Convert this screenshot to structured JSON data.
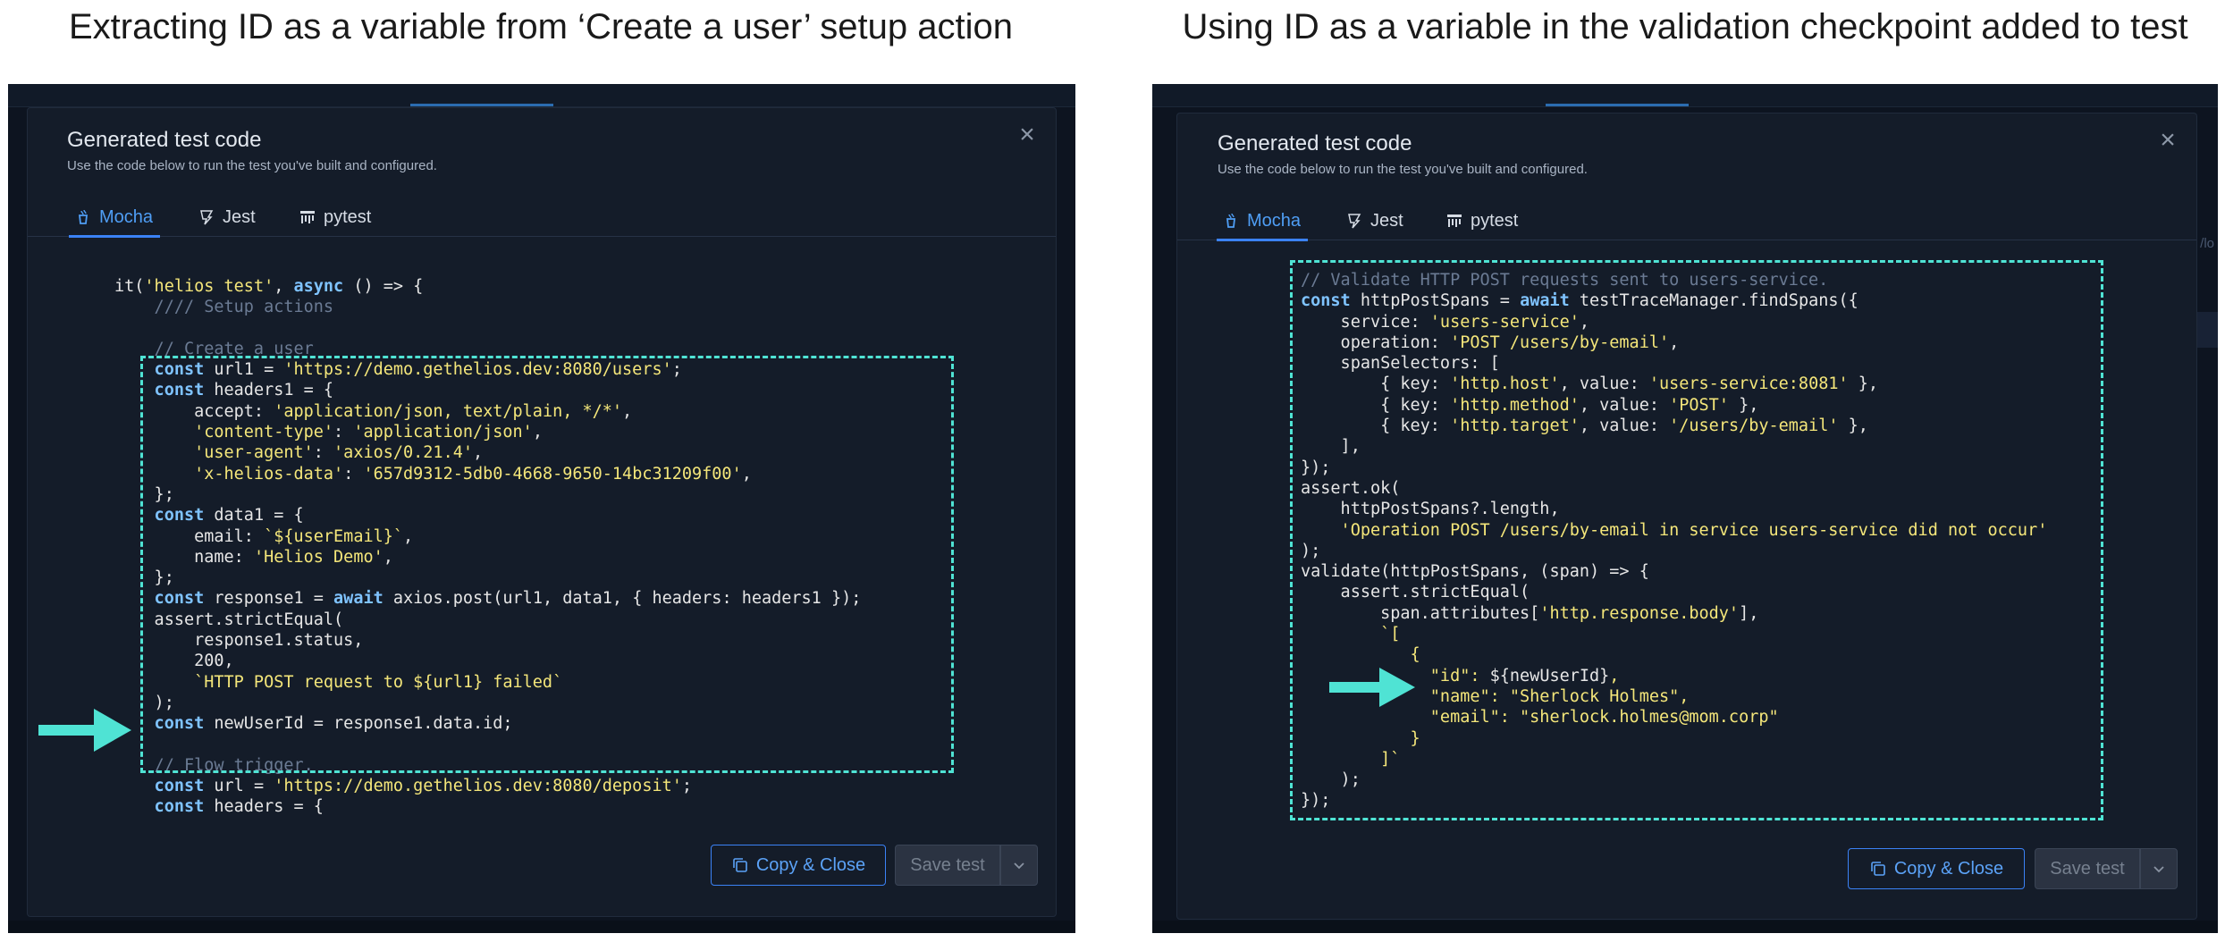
{
  "captions": {
    "left": "Extracting ID as a variable from ‘Create a user’ setup action",
    "right": "Using ID as a variable in the validation checkpoint added to test"
  },
  "modal": {
    "title": "Generated test code",
    "subtitle": "Use the code below to run the test you've built and configured.",
    "close_icon": "close-icon",
    "tabs": [
      {
        "label": "Mocha",
        "icon": "mocha-icon",
        "active": true
      },
      {
        "label": "Jest",
        "icon": "jest-icon",
        "active": false
      },
      {
        "label": "pytest",
        "icon": "pytest-icon",
        "active": false
      }
    ],
    "copy_button": "Copy & Close",
    "save_button": "Save test",
    "caret_icon": "chevron-down-icon"
  },
  "colors": {
    "accent": "#3b82f6",
    "highlight": "#4fe3d4",
    "keyword": "#7fc3ff",
    "string": "#f4e67a",
    "comment": "#6b7b94"
  },
  "left_code": [
    [
      [
        "p",
        "it("
      ],
      [
        "s",
        "'helios test'"
      ],
      [
        "p",
        ", "
      ],
      [
        "k",
        "async"
      ],
      [
        "p",
        " () => {"
      ]
    ],
    [
      [
        "c",
        "    //// Setup actions"
      ]
    ],
    [
      [
        "p",
        ""
      ]
    ],
    [
      [
        "c",
        "    // Create a user"
      ]
    ],
    [
      [
        "k",
        "    const"
      ],
      [
        "p",
        " url1 = "
      ],
      [
        "s",
        "'https://demo.gethelios.dev:8080/users'"
      ],
      [
        "p",
        ";"
      ]
    ],
    [
      [
        "k",
        "    const"
      ],
      [
        "p",
        " headers1 = {"
      ]
    ],
    [
      [
        "p",
        "        accept: "
      ],
      [
        "s",
        "'application/json, text/plain, */*'"
      ],
      [
        "p",
        ","
      ]
    ],
    [
      [
        "s",
        "        'content-type'"
      ],
      [
        "p",
        ": "
      ],
      [
        "s",
        "'application/json'"
      ],
      [
        "p",
        ","
      ]
    ],
    [
      [
        "s",
        "        'user-agent'"
      ],
      [
        "p",
        ": "
      ],
      [
        "s",
        "'axios/0.21.4'"
      ],
      [
        "p",
        ","
      ]
    ],
    [
      [
        "s",
        "        'x-helios-data'"
      ],
      [
        "p",
        ": "
      ],
      [
        "s",
        "'657d9312-5db0-4668-9650-14bc31209f00'"
      ],
      [
        "p",
        ","
      ]
    ],
    [
      [
        "p",
        "    };"
      ]
    ],
    [
      [
        "k",
        "    const"
      ],
      [
        "p",
        " data1 = {"
      ]
    ],
    [
      [
        "p",
        "        email: "
      ],
      [
        "s",
        "`${userEmail}`"
      ],
      [
        "p",
        ","
      ]
    ],
    [
      [
        "p",
        "        name: "
      ],
      [
        "s",
        "'Helios Demo'"
      ],
      [
        "p",
        ","
      ]
    ],
    [
      [
        "p",
        "    };"
      ]
    ],
    [
      [
        "k",
        "    const"
      ],
      [
        "p",
        " response1 = "
      ],
      [
        "k",
        "await"
      ],
      [
        "p",
        " axios.post(url1, data1, { headers: headers1 });"
      ]
    ],
    [
      [
        "p",
        "    assert.strictEqual("
      ]
    ],
    [
      [
        "p",
        "        response1.status,"
      ]
    ],
    [
      [
        "p",
        "        200,"
      ]
    ],
    [
      [
        "s",
        "        `HTTP POST request to ${url1} failed`"
      ]
    ],
    [
      [
        "p",
        "    );"
      ]
    ],
    [
      [
        "k",
        "    const"
      ],
      [
        "p",
        " newUserId = response1.data.id;"
      ]
    ],
    [
      [
        "p",
        ""
      ]
    ],
    [
      [
        "c",
        "    // Flow trigger."
      ]
    ],
    [
      [
        "k",
        "    const"
      ],
      [
        "p",
        " url = "
      ],
      [
        "s",
        "'https://demo.gethelios.dev:8080/deposit'"
      ],
      [
        "p",
        ";"
      ]
    ],
    [
      [
        "k",
        "    const"
      ],
      [
        "p",
        " headers = {"
      ]
    ]
  ],
  "right_code": [
    [
      [
        "c",
        "// Validate HTTP POST requests sent to users-service."
      ]
    ],
    [
      [
        "k",
        "const"
      ],
      [
        "p",
        " httpPostSpans = "
      ],
      [
        "k",
        "await"
      ],
      [
        "p",
        " testTraceManager.findSpans({"
      ]
    ],
    [
      [
        "p",
        "    service: "
      ],
      [
        "s",
        "'users-service'"
      ],
      [
        "p",
        ","
      ]
    ],
    [
      [
        "p",
        "    operation: "
      ],
      [
        "s",
        "'POST /users/by-email'"
      ],
      [
        "p",
        ","
      ]
    ],
    [
      [
        "p",
        "    spanSelectors: ["
      ]
    ],
    [
      [
        "p",
        "        { key: "
      ],
      [
        "s",
        "'http.host'"
      ],
      [
        "p",
        ", value: "
      ],
      [
        "s",
        "'users-service:8081'"
      ],
      [
        "p",
        " },"
      ]
    ],
    [
      [
        "p",
        "        { key: "
      ],
      [
        "s",
        "'http.method'"
      ],
      [
        "p",
        ", value: "
      ],
      [
        "s",
        "'POST'"
      ],
      [
        "p",
        " },"
      ]
    ],
    [
      [
        "p",
        "        { key: "
      ],
      [
        "s",
        "'http.target'"
      ],
      [
        "p",
        ", value: "
      ],
      [
        "s",
        "'/users/by-email'"
      ],
      [
        "p",
        " },"
      ]
    ],
    [
      [
        "p",
        "    ],"
      ]
    ],
    [
      [
        "p",
        "});"
      ]
    ],
    [
      [
        "p",
        "assert.ok("
      ]
    ],
    [
      [
        "p",
        "    httpPostSpans?.length,"
      ]
    ],
    [
      [
        "s",
        "    'Operation POST /users/by-email in service users-service did not occur'"
      ]
    ],
    [
      [
        "p",
        ");"
      ]
    ],
    [
      [
        "p",
        "validate(httpPostSpans, (span) => {"
      ]
    ],
    [
      [
        "p",
        "    assert.strictEqual("
      ]
    ],
    [
      [
        "p",
        "        span.attributes["
      ],
      [
        "s",
        "'http.response.body'"
      ],
      [
        "p",
        "],"
      ]
    ],
    [
      [
        "s",
        "        `["
      ]
    ],
    [
      [
        "s",
        "           {"
      ]
    ],
    [
      [
        "s",
        "             \"id\": "
      ],
      [
        "p",
        "${newUserId}"
      ],
      [
        "s",
        ","
      ]
    ],
    [
      [
        "s",
        "             \"name\": \"Sherlock Holmes\","
      ]
    ],
    [
      [
        "s",
        "             \"email\": \"sherlock.holmes@mom.corp\""
      ]
    ],
    [
      [
        "s",
        "           }"
      ]
    ],
    [
      [
        "s",
        "        ]`"
      ]
    ],
    [
      [
        "p",
        "    );"
      ]
    ],
    [
      [
        "p",
        "});"
      ]
    ]
  ]
}
